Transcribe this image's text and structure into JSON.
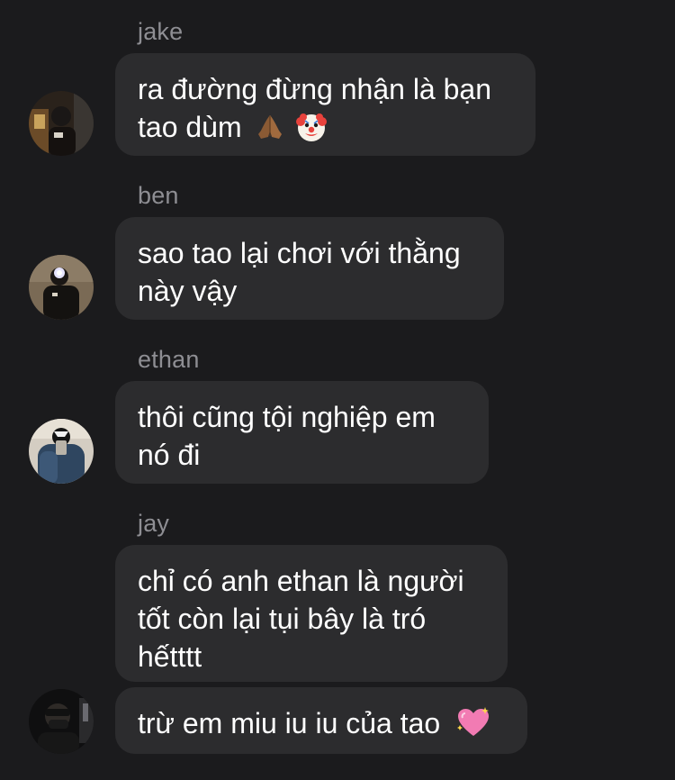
{
  "messages": [
    {
      "sender": "jake",
      "lines": [
        "ra đường đừng nhận là bạn",
        "tao dùm"
      ],
      "emoji": [
        "folded-hands-emoji",
        "clown-face-emoji"
      ]
    },
    {
      "sender": "ben",
      "lines": [
        "sao tao lại chơi với thằng",
        "này vậy"
      ]
    },
    {
      "sender": "ethan",
      "lines": [
        "thôi cũng tội nghiệp em",
        "nó đi"
      ]
    },
    {
      "sender": "jay",
      "lines": [
        "chỉ có anh ethan là người",
        "tốt còn lại tụi bây là tró",
        "hếtttt"
      ]
    },
    {
      "sender": "jay",
      "lines": [
        "trừ em miu iu iu của tao"
      ],
      "emoji": [
        "sparkling-heart-emoji"
      ]
    }
  ],
  "colors": {
    "background": "#1b1b1d",
    "bubble": "#2c2c2e",
    "sender_name": "#8e8e93",
    "text": "#ffffff"
  }
}
